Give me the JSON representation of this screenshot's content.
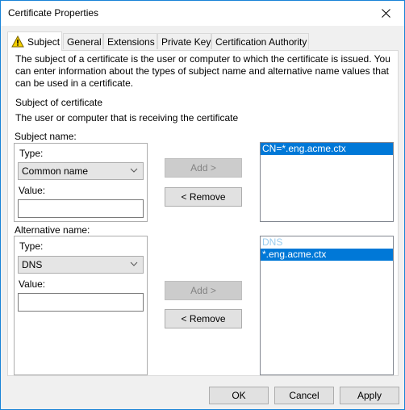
{
  "window": {
    "title": "Certificate Properties",
    "close_icon": "close-icon"
  },
  "tabs": [
    {
      "label": "Subject",
      "active": true,
      "icon": "warning-icon"
    },
    {
      "label": "General",
      "active": false
    },
    {
      "label": "Extensions",
      "active": false
    },
    {
      "label": "Private Key",
      "active": false
    },
    {
      "label": "Certification Authority",
      "active": false
    }
  ],
  "subject_tab": {
    "description": "The subject of a certificate is the user or computer to which the certificate is issued. You can enter information about the types of subject name and alternative name values that can be used in a certificate.",
    "section_title": "Subject of certificate",
    "section_subtitle": "The user or computer that is receiving the certificate",
    "subject_name": {
      "label": "Subject name:",
      "type_label": "Type:",
      "type_value": "Common name",
      "value_label": "Value:",
      "value": "",
      "add_label": "Add >",
      "remove_label": "< Remove",
      "list_items": [
        {
          "text": "CN=*.eng.acme.ctx",
          "selected": true
        }
      ]
    },
    "alternative_name": {
      "label": "Alternative name:",
      "type_label": "Type:",
      "type_value": "DNS",
      "value_label": "Value:",
      "value": "",
      "add_label": "Add >",
      "remove_label": "< Remove",
      "list_header": "DNS",
      "list_items": [
        {
          "text": "*.eng.acme.ctx",
          "selected": true
        }
      ]
    }
  },
  "footer": {
    "ok_label": "OK",
    "cancel_label": "Cancel",
    "apply_label": "Apply"
  },
  "colors": {
    "accent": "#0078d7",
    "window_border": "#1883d7",
    "list_header": "#99ccee"
  }
}
